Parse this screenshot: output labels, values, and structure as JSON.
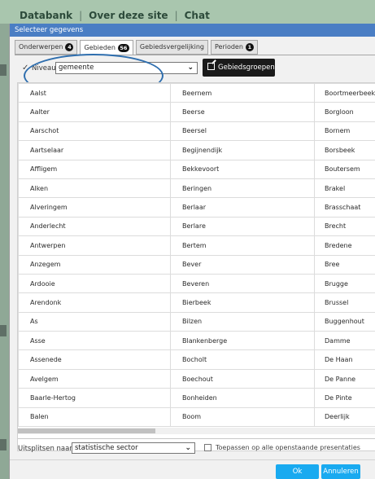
{
  "background_nav": {
    "item1": "Databank",
    "item2": "Over deze site",
    "item3": "Chat"
  },
  "dialog": {
    "title": "Selecteer gegevens",
    "tabs": [
      {
        "label": "Onderwerpen",
        "badge": "4"
      },
      {
        "label": "Gebieden",
        "badge": "56"
      },
      {
        "label": "Gebiedsvergelijking",
        "badge": ""
      },
      {
        "label": "Perioden",
        "badge": "1"
      }
    ],
    "active_tab": "Gebieden",
    "toolbar": {
      "check_icon": "check-icon",
      "niveau_label": "Niveau",
      "niveau_value": "gemeente",
      "groups_button": "Gebiedsgroepen",
      "side_button": "«"
    },
    "areas": [
      [
        "Aalst",
        "Beernem",
        "Boortmeerbeek"
      ],
      [
        "Aalter",
        "Beerse",
        "Borgloon"
      ],
      [
        "Aarschot",
        "Beersel",
        "Bornem"
      ],
      [
        "Aartselaar",
        "Begijnendijk",
        "Borsbeek"
      ],
      [
        "Affligem",
        "Bekkevoort",
        "Boutersem"
      ],
      [
        "Alken",
        "Beringen",
        "Brakel"
      ],
      [
        "Alveringem",
        "Berlaar",
        "Brasschaat"
      ],
      [
        "Anderlecht",
        "Berlare",
        "Brecht"
      ],
      [
        "Antwerpen",
        "Bertem",
        "Bredene"
      ],
      [
        "Anzegem",
        "Bever",
        "Bree"
      ],
      [
        "Ardooie",
        "Beveren",
        "Brugge"
      ],
      [
        "Arendonk",
        "Bierbeek",
        "Brussel"
      ],
      [
        "As",
        "Bilzen",
        "Buggenhout"
      ],
      [
        "Asse",
        "Blankenberge",
        "Damme"
      ],
      [
        "Assenede",
        "Bocholt",
        "De Haan"
      ],
      [
        "Avelgem",
        "Boechout",
        "De Panne"
      ],
      [
        "Baarle-Hertog",
        "Bonheiden",
        "De Pinte"
      ],
      [
        "Balen",
        "Boom",
        "Deerlijk"
      ]
    ],
    "bottom": {
      "split_label": "Uitsplitsen naar",
      "split_value": "statistische sector",
      "apply_all_label": "Toepassen op alle openstaande presentaties",
      "apply_all_checked": false
    },
    "buttons": {
      "ok": "Ok",
      "cancel": "Annuleren"
    },
    "colors": {
      "titlebar": "#4a7ec4",
      "primary_button": "#19aaf0",
      "highlight_circle": "#2e6eae"
    }
  }
}
